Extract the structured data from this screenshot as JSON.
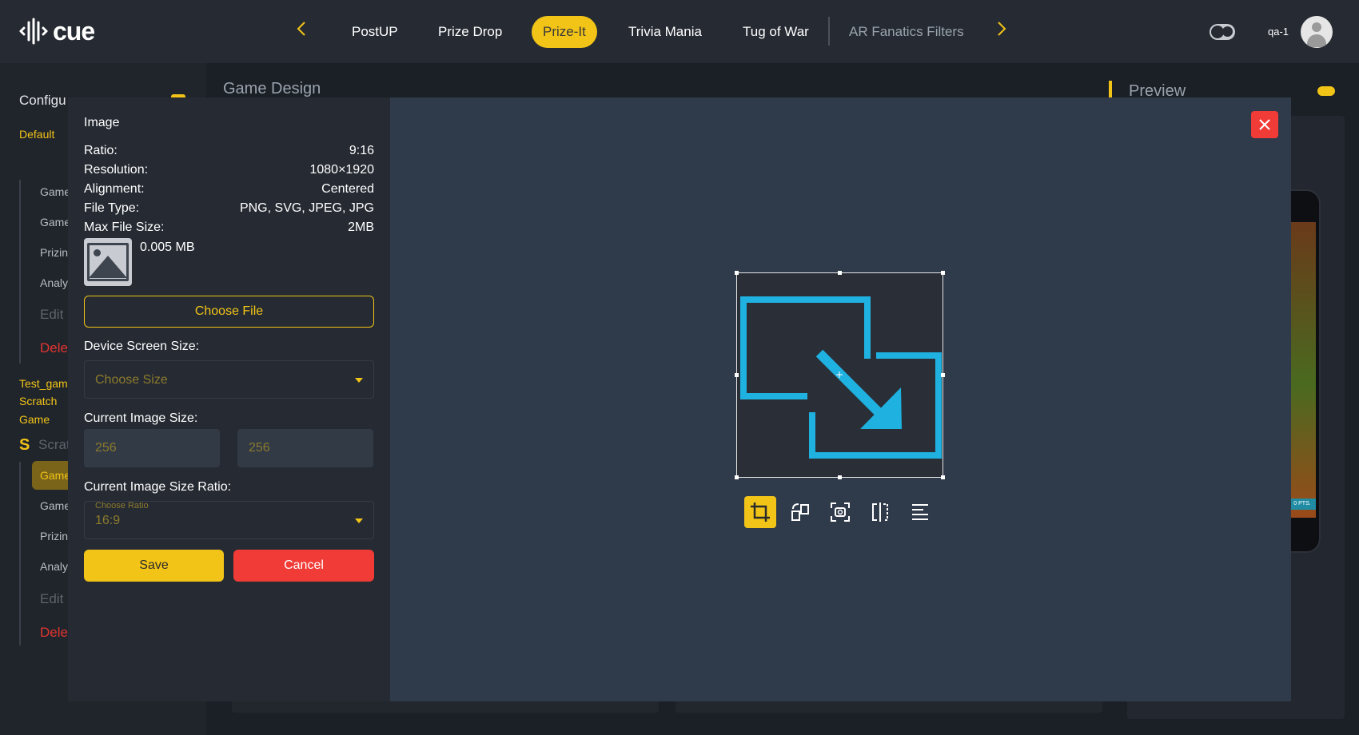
{
  "app": {
    "logo_text": "cue",
    "user": "qa-1"
  },
  "nav": {
    "tabs": [
      {
        "label": "PostUP"
      },
      {
        "label": "Prize Drop"
      },
      {
        "label": "Prize-It",
        "active": true
      },
      {
        "label": "Trivia Mania"
      },
      {
        "label": "Tug of War"
      },
      {
        "label": "AR Fanatics Filters"
      }
    ]
  },
  "sidebar": {
    "title": "Configu",
    "default": "Default",
    "items_top": [
      "Game",
      "Game",
      "Prizin",
      "Analy"
    ],
    "edit": "Edit",
    "delete": "Dele",
    "group_lines": [
      "Test_gam",
      "Scratch",
      "Game"
    ],
    "scratch_label": "Scrat",
    "items_bottom": [
      "Game",
      "Game",
      "Prizin",
      "Analy"
    ]
  },
  "main": {
    "title": "Game Design",
    "preview_title": "Preview",
    "phone_tag": "0 PTS."
  },
  "modal": {
    "heading": "Image",
    "info": [
      {
        "key": "Ratio:",
        "value": "9:16"
      },
      {
        "key": "Resolution:",
        "value": "1080×1920"
      },
      {
        "key": "Alignment:",
        "value": "Centered"
      },
      {
        "key": "File Type:",
        "value": "PNG, SVG, JPEG, JPG"
      },
      {
        "key": "Max File Size:",
        "value": "2MB"
      }
    ],
    "file_size": "0.005 MB",
    "choose_file_label": "Choose File",
    "device_size_label": "Device Screen Size:",
    "device_size_placeholder": "Choose Size",
    "current_size_label": "Current Image Size:",
    "width_value": "256",
    "height_value": "256",
    "ratio_label": "Current Image Size Ratio:",
    "ratio_float_label": "Choose Ratio",
    "ratio_value": "16:9",
    "save_label": "Save",
    "cancel_label": "Cancel",
    "close_symbol": "✕"
  },
  "toolbar": {
    "tools": [
      "crop-icon",
      "rotate-icon",
      "screenshot-icon",
      "flip-icon",
      "align-icon"
    ]
  },
  "colors": {
    "accent": "#f2c417",
    "danger": "#f03b37",
    "image_blue": "#1fb1e0"
  }
}
